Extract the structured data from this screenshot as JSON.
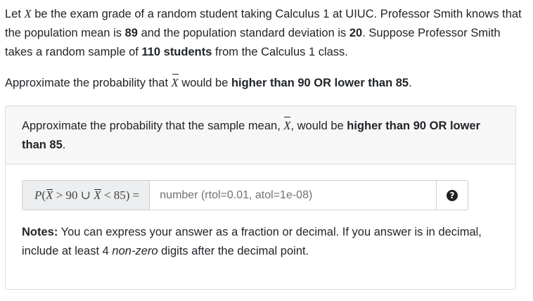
{
  "intro": {
    "t1": "Let ",
    "var_x": "X",
    "t2": " be the exam grade of a random student taking Calculus 1 at UIUC. Professor Smith knows that the population mean is ",
    "mean": "89",
    "t3": " and the population standard deviation is ",
    "sd": "20",
    "t4": ". Suppose Professor Smith takes a random sample of ",
    "sample": "110 students",
    "t5": " from the Calculus 1 class."
  },
  "question": {
    "t1": "Approximate the probability that ",
    "xbar": "X",
    "t2": " would be ",
    "bold": "higher than 90 OR lower than 85",
    "t3": "."
  },
  "card": {
    "header": {
      "t1": "Approximate the probability that the sample mean, ",
      "xbar": "X",
      "t2": ", would be ",
      "bold": "higher than 90 OR lower than 85",
      "t3": "."
    },
    "answer": {
      "p": "P",
      "open": "(",
      "xbar1": "X",
      "op1": " > 90 ∪ ",
      "xbar2": "X",
      "op2": " < 85) =",
      "placeholder": "number (rtol=0.01, atol=1e-08)",
      "value": "",
      "help_glyph": "?"
    },
    "notes": {
      "label": "Notes:",
      "t1": " You can express your answer as a fraction or decimal. If you answer is in decimal, include at least 4 ",
      "em": "non-zero",
      "t2": " digits after the decimal point."
    }
  }
}
